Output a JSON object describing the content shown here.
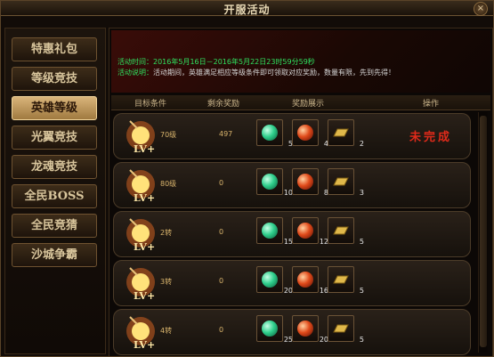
{
  "window": {
    "title": "开服活动",
    "close": "×"
  },
  "sidebar": {
    "items": [
      {
        "label": "特惠礼包",
        "active": false
      },
      {
        "label": "等级竞技",
        "active": false
      },
      {
        "label": "英雄等级",
        "active": true
      },
      {
        "label": "光翼竞技",
        "active": false
      },
      {
        "label": "龙魂竞技",
        "active": false
      },
      {
        "label": "全民BOSS",
        "active": false
      },
      {
        "label": "全民竞猜",
        "active": false
      },
      {
        "label": "沙城争霸",
        "active": false
      }
    ]
  },
  "info": {
    "time_label": "活动时间：",
    "time_value": "2016年5月16日－2016年5月22日23时59分59秒",
    "desc_label": "活动说明：",
    "desc_value": "活动期间，英雄满足相应等级条件即可领取对应奖励，数量有限，先到先得！"
  },
  "table": {
    "headers": {
      "target": "目标条件",
      "remaining": "剩余奖励",
      "rewards": "奖励展示",
      "action": "操作"
    },
    "rows": [
      {
        "requirement": "70级",
        "remaining": "497",
        "rewards": [
          "5",
          "4",
          "2"
        ],
        "status": "未完成"
      },
      {
        "requirement": "80级",
        "remaining": "0",
        "rewards": [
          "10",
          "8",
          "3"
        ],
        "status": ""
      },
      {
        "requirement": "2转",
        "remaining": "0",
        "rewards": [
          "15",
          "12",
          "5"
        ],
        "status": ""
      },
      {
        "requirement": "3转",
        "remaining": "0",
        "rewards": [
          "20",
          "16",
          "5"
        ],
        "status": ""
      },
      {
        "requirement": "4转",
        "remaining": "0",
        "rewards": [
          "25",
          "20",
          "5"
        ],
        "status": ""
      }
    ],
    "level_badge": "LV+"
  },
  "colors": {
    "accent_green": "#2fe05f",
    "status_red": "#e02a1a",
    "gold": "#d9b46c",
    "active_tab": "#d9b47a"
  }
}
